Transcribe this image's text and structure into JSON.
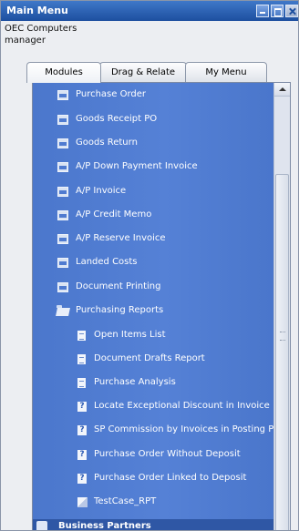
{
  "window": {
    "title": "Main Menu",
    "company": "OEC Computers",
    "user": "manager"
  },
  "tabs": [
    {
      "label": "Modules",
      "accesskey": "o",
      "active": true
    },
    {
      "label": "Drag & Relate",
      "accesskey": "D",
      "active": false
    },
    {
      "label": "My Menu",
      "accesskey": "y",
      "active": false
    }
  ],
  "menu": {
    "items": [
      {
        "label": "Purchase Order",
        "icon": "form-icon"
      },
      {
        "label": "Goods Receipt PO",
        "icon": "form-icon"
      },
      {
        "label": "Goods Return",
        "icon": "form-icon"
      },
      {
        "label": "A/P Down Payment Invoice",
        "icon": "form-icon"
      },
      {
        "label": "A/P Invoice",
        "icon": "form-icon"
      },
      {
        "label": "A/P Credit Memo",
        "icon": "form-icon"
      },
      {
        "label": "A/P Reserve Invoice",
        "icon": "form-icon"
      },
      {
        "label": "Landed Costs",
        "icon": "form-icon"
      },
      {
        "label": "Document Printing",
        "icon": "form-icon"
      },
      {
        "label": "Purchasing Reports",
        "icon": "open-folder-icon"
      }
    ],
    "reports": [
      {
        "label": "Open Items List",
        "icon": "report-icon"
      },
      {
        "label": "Document Drafts Report",
        "icon": "report-icon"
      },
      {
        "label": "Purchase Analysis",
        "icon": "report-icon"
      },
      {
        "label": "Locate Exceptional Discount in Invoice",
        "icon": "query-icon"
      },
      {
        "label": "SP Commission by Invoices in Posting Period",
        "icon": "query-icon"
      },
      {
        "label": "Purchase Order Without Deposit",
        "icon": "query-icon"
      },
      {
        "label": "Purchase Order Linked to Deposit",
        "icon": "query-icon"
      },
      {
        "label": "TestCase_RPT",
        "icon": "crystal-report-icon"
      }
    ],
    "next_module": "Business Partners"
  },
  "colors": {
    "list_background": "#5581d6",
    "titlebar": "#1d4f9f",
    "text": "#ffffff"
  }
}
